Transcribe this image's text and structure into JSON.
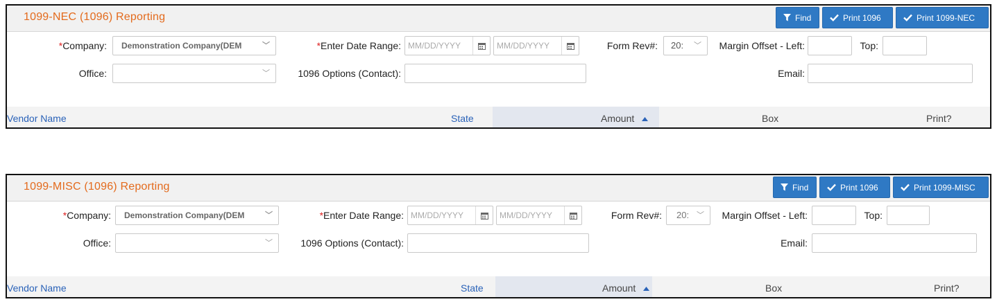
{
  "panels": [
    {
      "title": "1099-NEC (1096) Reporting",
      "buttons": {
        "find": "Find",
        "print1096": "Print 1096",
        "print_form": "Print 1099-NEC"
      },
      "company_label": "Company:",
      "company_value": "Demonstration Company(DEM",
      "date_range_label": "Enter Date Range:",
      "date_placeholder_start": "MM/DD/YYYY",
      "date_placeholder_end": "MM/DD/YYYY",
      "form_rev_label": "Form Rev#:",
      "form_rev_value": "20:",
      "margin_left_label": "Margin Offset - Left:",
      "top_label": "Top:",
      "office_label": "Office:",
      "options_label": "1096 Options (Contact):",
      "email_label": "Email:",
      "columns": {
        "vendor": "Vendor Name",
        "state": "State",
        "amount": "Amount",
        "box": "Box",
        "print": "Print?"
      }
    },
    {
      "title": "1099-MISC (1096) Reporting",
      "buttons": {
        "find": "Find",
        "print1096": "Print 1096",
        "print_form": "Print 1099-MISC"
      },
      "company_label": "Company:",
      "company_value": "Demonstration Company(DEM",
      "date_range_label": "Enter Date Range:",
      "date_placeholder_start": "MM/DD/YYYY",
      "date_placeholder_end": "MM/DD/YYYY",
      "form_rev_label": "Form Rev#:",
      "form_rev_value": "20:",
      "margin_left_label": "Margin Offset - Left:",
      "top_label": "Top:",
      "office_label": "Office:",
      "options_label": "1096 Options (Contact):",
      "email_label": "Email:",
      "columns": {
        "vendor": "Vendor Name",
        "state": "State",
        "amount": "Amount",
        "box": "Box",
        "print": "Print?"
      }
    }
  ],
  "required_marker": "*",
  "colors": {
    "title": "#e36a1c",
    "button": "#2f79c4",
    "link": "#2a62b8",
    "required": "#d22222",
    "sorted_column": "#e3e7ef"
  },
  "icons": {
    "find": "filter-icon",
    "print": "checkmark-icon",
    "calendar": "calendar-icon",
    "dropdown": "chevron-down-icon",
    "sort": "sort-ascending-icon"
  }
}
